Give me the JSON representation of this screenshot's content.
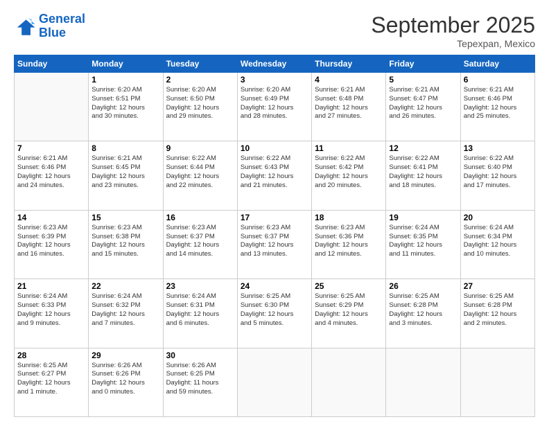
{
  "logo": {
    "line1": "General",
    "line2": "Blue"
  },
  "title": "September 2025",
  "location": "Tepexpan, Mexico",
  "days_of_week": [
    "Sunday",
    "Monday",
    "Tuesday",
    "Wednesday",
    "Thursday",
    "Friday",
    "Saturday"
  ],
  "weeks": [
    [
      {
        "day": "",
        "info": ""
      },
      {
        "day": "1",
        "info": "Sunrise: 6:20 AM\nSunset: 6:51 PM\nDaylight: 12 hours\nand 30 minutes."
      },
      {
        "day": "2",
        "info": "Sunrise: 6:20 AM\nSunset: 6:50 PM\nDaylight: 12 hours\nand 29 minutes."
      },
      {
        "day": "3",
        "info": "Sunrise: 6:20 AM\nSunset: 6:49 PM\nDaylight: 12 hours\nand 28 minutes."
      },
      {
        "day": "4",
        "info": "Sunrise: 6:21 AM\nSunset: 6:48 PM\nDaylight: 12 hours\nand 27 minutes."
      },
      {
        "day": "5",
        "info": "Sunrise: 6:21 AM\nSunset: 6:47 PM\nDaylight: 12 hours\nand 26 minutes."
      },
      {
        "day": "6",
        "info": "Sunrise: 6:21 AM\nSunset: 6:46 PM\nDaylight: 12 hours\nand 25 minutes."
      }
    ],
    [
      {
        "day": "7",
        "info": "Sunrise: 6:21 AM\nSunset: 6:46 PM\nDaylight: 12 hours\nand 24 minutes."
      },
      {
        "day": "8",
        "info": "Sunrise: 6:21 AM\nSunset: 6:45 PM\nDaylight: 12 hours\nand 23 minutes."
      },
      {
        "day": "9",
        "info": "Sunrise: 6:22 AM\nSunset: 6:44 PM\nDaylight: 12 hours\nand 22 minutes."
      },
      {
        "day": "10",
        "info": "Sunrise: 6:22 AM\nSunset: 6:43 PM\nDaylight: 12 hours\nand 21 minutes."
      },
      {
        "day": "11",
        "info": "Sunrise: 6:22 AM\nSunset: 6:42 PM\nDaylight: 12 hours\nand 20 minutes."
      },
      {
        "day": "12",
        "info": "Sunrise: 6:22 AM\nSunset: 6:41 PM\nDaylight: 12 hours\nand 18 minutes."
      },
      {
        "day": "13",
        "info": "Sunrise: 6:22 AM\nSunset: 6:40 PM\nDaylight: 12 hours\nand 17 minutes."
      }
    ],
    [
      {
        "day": "14",
        "info": "Sunrise: 6:23 AM\nSunset: 6:39 PM\nDaylight: 12 hours\nand 16 minutes."
      },
      {
        "day": "15",
        "info": "Sunrise: 6:23 AM\nSunset: 6:38 PM\nDaylight: 12 hours\nand 15 minutes."
      },
      {
        "day": "16",
        "info": "Sunrise: 6:23 AM\nSunset: 6:37 PM\nDaylight: 12 hours\nand 14 minutes."
      },
      {
        "day": "17",
        "info": "Sunrise: 6:23 AM\nSunset: 6:37 PM\nDaylight: 12 hours\nand 13 minutes."
      },
      {
        "day": "18",
        "info": "Sunrise: 6:23 AM\nSunset: 6:36 PM\nDaylight: 12 hours\nand 12 minutes."
      },
      {
        "day": "19",
        "info": "Sunrise: 6:24 AM\nSunset: 6:35 PM\nDaylight: 12 hours\nand 11 minutes."
      },
      {
        "day": "20",
        "info": "Sunrise: 6:24 AM\nSunset: 6:34 PM\nDaylight: 12 hours\nand 10 minutes."
      }
    ],
    [
      {
        "day": "21",
        "info": "Sunrise: 6:24 AM\nSunset: 6:33 PM\nDaylight: 12 hours\nand 9 minutes."
      },
      {
        "day": "22",
        "info": "Sunrise: 6:24 AM\nSunset: 6:32 PM\nDaylight: 12 hours\nand 7 minutes."
      },
      {
        "day": "23",
        "info": "Sunrise: 6:24 AM\nSunset: 6:31 PM\nDaylight: 12 hours\nand 6 minutes."
      },
      {
        "day": "24",
        "info": "Sunrise: 6:25 AM\nSunset: 6:30 PM\nDaylight: 12 hours\nand 5 minutes."
      },
      {
        "day": "25",
        "info": "Sunrise: 6:25 AM\nSunset: 6:29 PM\nDaylight: 12 hours\nand 4 minutes."
      },
      {
        "day": "26",
        "info": "Sunrise: 6:25 AM\nSunset: 6:28 PM\nDaylight: 12 hours\nand 3 minutes."
      },
      {
        "day": "27",
        "info": "Sunrise: 6:25 AM\nSunset: 6:28 PM\nDaylight: 12 hours\nand 2 minutes."
      }
    ],
    [
      {
        "day": "28",
        "info": "Sunrise: 6:25 AM\nSunset: 6:27 PM\nDaylight: 12 hours\nand 1 minute."
      },
      {
        "day": "29",
        "info": "Sunrise: 6:26 AM\nSunset: 6:26 PM\nDaylight: 12 hours\nand 0 minutes."
      },
      {
        "day": "30",
        "info": "Sunrise: 6:26 AM\nSunset: 6:25 PM\nDaylight: 11 hours\nand 59 minutes."
      },
      {
        "day": "",
        "info": ""
      },
      {
        "day": "",
        "info": ""
      },
      {
        "day": "",
        "info": ""
      },
      {
        "day": "",
        "info": ""
      }
    ]
  ]
}
